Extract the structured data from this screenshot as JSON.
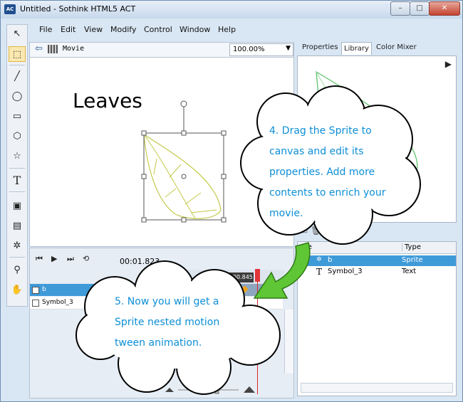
{
  "window": {
    "title": "Untitled - Sothink HTML5 ACT",
    "app_icon_text": "AC",
    "buttons": {
      "minimize": "–",
      "maximize": "□",
      "close": "✕"
    }
  },
  "menu": {
    "items": [
      "File",
      "Edit",
      "View",
      "Modify",
      "Control",
      "Window",
      "Help"
    ]
  },
  "toolbox": {
    "tools": [
      {
        "name": "select-arrow-icon",
        "glyph": "↖"
      },
      {
        "name": "transform-icon",
        "glyph": "⬚"
      },
      {
        "name": "line-icon",
        "glyph": "╱"
      },
      {
        "name": "ellipse-icon",
        "glyph": "◯"
      },
      {
        "name": "rectangle-icon",
        "glyph": "▭"
      },
      {
        "name": "hexagon-icon",
        "glyph": "⬡"
      },
      {
        "name": "star-icon",
        "glyph": "☆"
      },
      {
        "name": "text-tool-icon",
        "glyph": "T"
      },
      {
        "name": "image-tool-icon",
        "glyph": "▣"
      },
      {
        "name": "frame-tool-icon",
        "glyph": "▤"
      },
      {
        "name": "component-tool-icon",
        "glyph": "✲"
      },
      {
        "name": "zoom-tool-icon",
        "glyph": "⚲"
      },
      {
        "name": "hand-tool-icon",
        "glyph": "✋"
      }
    ]
  },
  "stage": {
    "scene_label": "Movie",
    "zoom": "100.00%",
    "canvas_text": "Leaves"
  },
  "timeline": {
    "time": "00:01.823",
    "badge_time": "0:00.845",
    "layers": [
      "b",
      "Symbol_3"
    ]
  },
  "panel": {
    "tabs": [
      "Properties",
      "Library",
      "Color Mixer"
    ],
    "active_tab": "Library",
    "library": {
      "columns": [
        "me",
        "Type"
      ],
      "rows": [
        {
          "name": "b",
          "type": "Sprite"
        },
        {
          "name": "Symbol_3",
          "type": "Text"
        }
      ]
    }
  },
  "callouts": {
    "step4": [
      "4. Drag the Sprite to",
      "canvas and edit its",
      "properties. Add more",
      "contents to enrich your",
      "movie."
    ],
    "step5": [
      "5. Now you will get a",
      "Sprite nested motion",
      "tween animation."
    ]
  },
  "colors": {
    "accent": "#3f9ad8",
    "callout_text": "#0d8fd6",
    "leaf_yellow": "#c4c94a",
    "leaf_green": "#5cc46a"
  }
}
